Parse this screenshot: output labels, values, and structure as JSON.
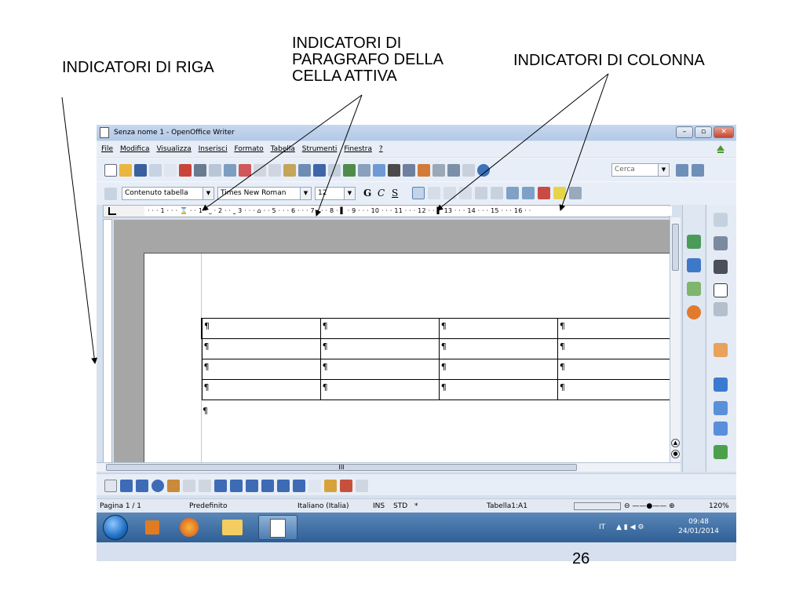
{
  "callouts": {
    "riga": "INDICATORI DI RIGA",
    "paragrafo": "INDICATORI DI\nPARAGRAFO DELLA\nCELLA ATTIVA",
    "colonna": "INDICATORI DI COLONNA"
  },
  "page_number": "26",
  "window": {
    "title": "Senza nome 1 - OpenOffice Writer",
    "controls": {
      "minimize": "–",
      "maximize": "▫",
      "close": "✕"
    }
  },
  "menu": [
    "File",
    "Modifica",
    "Visualizza",
    "Inserisci",
    "Formato",
    "Tabella",
    "Strumenti",
    "Finestra",
    "?"
  ],
  "toolbar": {
    "search_value": "Cerca",
    "paragraph_style": "Contenuto tabella",
    "font_name": "Times New Roman",
    "font_size": "12",
    "bold": "G",
    "italic": "C",
    "underline": "S"
  },
  "ruler": {
    "text": "· · · 1 · · · ⌛ · · 1 · ˽ · 2 · · ˽ 3 · · · ⌂ · · 5 · · · 6 · · · 7 · · · 8 · ▌ · 9 · · · 10 · · · 11 · · · 12 · · ▌ 13 · · · 14 · · · 15 · · · 16 · ·"
  },
  "table": {
    "rows": [
      [
        "¶",
        "¶",
        "¶",
        "¶"
      ],
      [
        "¶",
        "¶",
        "¶",
        "¶"
      ],
      [
        "¶",
        "¶",
        "¶",
        "¶"
      ],
      [
        "¶",
        "¶",
        "¶",
        "¶"
      ]
    ],
    "after_paragraph": "¶"
  },
  "hscroll_thumb": "III",
  "status": {
    "page": "Pagina 1 / 1",
    "style": "Predefinito",
    "language": "Italiano (Italia)",
    "ins": "INS",
    "std": "STD",
    "star": "*",
    "cell": "Tabella1:A1",
    "zoom": "120%"
  },
  "taskbar": {
    "language": "IT",
    "time": "09:48",
    "date": "24/01/2014"
  }
}
